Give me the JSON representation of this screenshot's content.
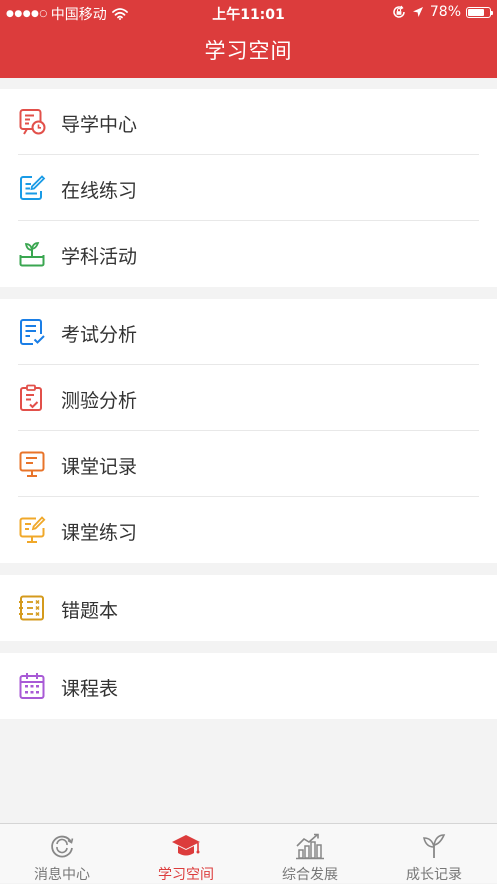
{
  "status_bar": {
    "signal_dots": "●●●●○",
    "carrier": "中国移动",
    "time": "上午11:01",
    "battery_percent": "78%",
    "battery_level": 0.78
  },
  "header": {
    "title": "学习空间"
  },
  "groups": [
    {
      "items": [
        {
          "label": "导学中心",
          "icon": "guide-board-clock-icon",
          "color": "#e2504a"
        },
        {
          "label": "在线练习",
          "icon": "edit-doc-icon",
          "color": "#1a9be6"
        },
        {
          "label": "学科活动",
          "icon": "sprout-box-icon",
          "color": "#3aa650"
        }
      ]
    },
    {
      "items": [
        {
          "label": "考试分析",
          "icon": "doc-check-icon",
          "color": "#1a7ee6"
        },
        {
          "label": "测验分析",
          "icon": "clipboard-check-icon",
          "color": "#e2504a"
        },
        {
          "label": "课堂记录",
          "icon": "board-record-icon",
          "color": "#e8742a"
        },
        {
          "label": "课堂练习",
          "icon": "board-edit-icon",
          "color": "#f0a82a"
        }
      ]
    },
    {
      "items": [
        {
          "label": "错题本",
          "icon": "wrong-list-icon",
          "color": "#d49a1c"
        }
      ]
    },
    {
      "items": [
        {
          "label": "课程表",
          "icon": "calendar-icon",
          "color": "#a85ad6"
        }
      ]
    }
  ],
  "tabbar": {
    "tabs": [
      {
        "label": "消息中心",
        "icon": "message-refresh-icon"
      },
      {
        "label": "学习空间",
        "icon": "graduation-cap-icon",
        "active": true
      },
      {
        "label": "综合发展",
        "icon": "growth-chart-icon"
      },
      {
        "label": "成长记录",
        "icon": "sprout-icon"
      }
    ],
    "active_color": "#dc3c3c",
    "inactive_color": "#888888"
  },
  "colors": {
    "header_bg": "#dc3c3c",
    "page_bg": "#f3f3f3"
  }
}
